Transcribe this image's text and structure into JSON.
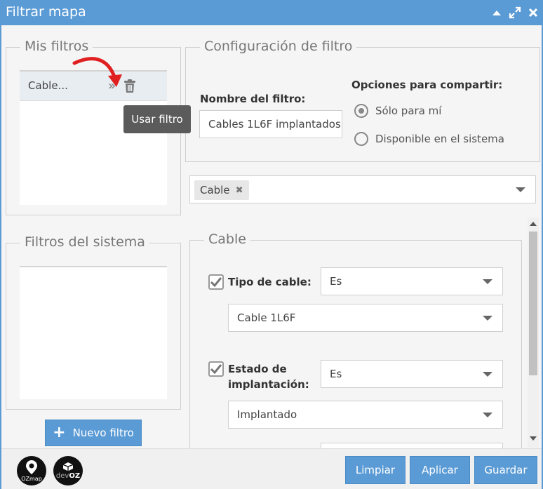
{
  "window": {
    "title": "Filtrar mapa"
  },
  "my_filters": {
    "legend": "Mis filtros",
    "items": [
      {
        "label": "Cable..."
      }
    ],
    "tooltip": "Usar filtro"
  },
  "system_filters": {
    "legend": "Filtros del sistema"
  },
  "config": {
    "legend": "Configuración de filtro",
    "name_label": "Nombre del filtro:",
    "name_value": "Cables 1L6F implantados",
    "share_label": "Opciones para compartir:",
    "share_options": [
      {
        "label": "Sólo para mí",
        "selected": true
      },
      {
        "label": "Disponible en el sistema",
        "selected": false
      }
    ]
  },
  "entity_select": {
    "tags": [
      {
        "label": "Cable"
      }
    ]
  },
  "cable_group": {
    "legend": "Cable",
    "criteria": [
      {
        "label": "Tipo de cable:",
        "checked": true,
        "operator": "Es",
        "value": "Cable 1L6F"
      },
      {
        "label_line1": "Estado de",
        "label_line2": "implantación:",
        "checked": true,
        "operator": "Es",
        "value": "Implantado"
      }
    ]
  },
  "buttons": {
    "new_filter": "Nuevo filtro",
    "clear": "Limpiar",
    "apply": "Aplicar",
    "save": "Guardar"
  },
  "logos": [
    {
      "name": "ozmap-logo",
      "text": "OZmap"
    },
    {
      "name": "devoz-logo",
      "text_prefix": "dev",
      "text_suffix": "OZ"
    }
  ],
  "colors": {
    "accent": "#5b9bd5",
    "arrow": "#e02020"
  }
}
